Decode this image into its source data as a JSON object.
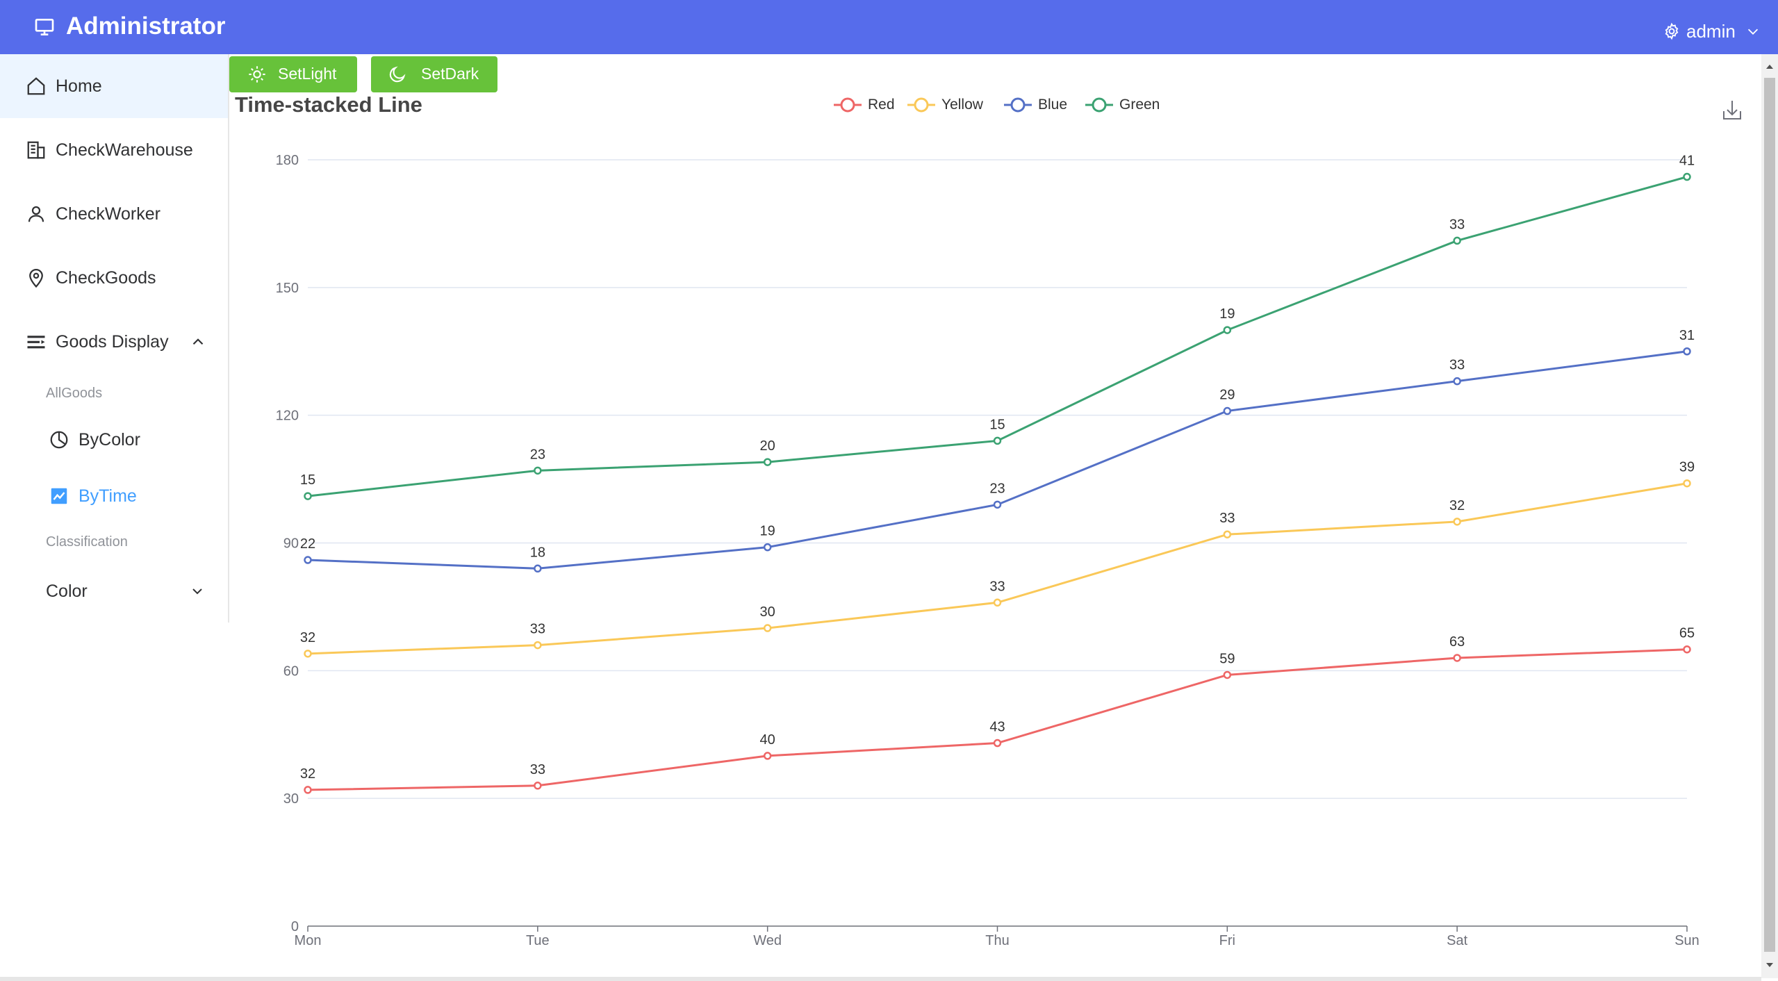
{
  "header": {
    "title": "Administrator",
    "user": "admin",
    "bg_color": "#566ceb"
  },
  "sidebar": {
    "items": [
      {
        "label": "Home",
        "icon": "home-icon"
      },
      {
        "label": "CheckWarehouse",
        "icon": "building-icon"
      },
      {
        "label": "CheckWorker",
        "icon": "user-icon"
      },
      {
        "label": "CheckGoods",
        "icon": "location-pin-icon"
      },
      {
        "label": "Goods Display",
        "icon": "list-icon"
      }
    ],
    "group_allgoods": "AllGoods",
    "sub_items": [
      {
        "label": "ByColor",
        "icon": "pie-chart-icon"
      },
      {
        "label": "ByTime",
        "icon": "line-chart-icon"
      }
    ],
    "group_classification": "Classification",
    "color_menu": "Color",
    "active_color": "#ecf5ff",
    "current_color": "#409eff"
  },
  "buttons": {
    "light": "SetLight",
    "dark": "SetDark",
    "color": "#67c23a"
  },
  "chart_data": {
    "type": "line",
    "title": "Time-stacked Line",
    "stacked": true,
    "categories": [
      "Mon",
      "Tue",
      "Wed",
      "Thu",
      "Fri",
      "Sat",
      "Sun"
    ],
    "series": [
      {
        "name": "Red",
        "color": "#ee6666",
        "values": [
          32,
          33,
          40,
          43,
          59,
          63,
          65
        ]
      },
      {
        "name": "Yellow",
        "color": "#fac858",
        "values": [
          32,
          33,
          30,
          33,
          33,
          32,
          39
        ]
      },
      {
        "name": "Blue",
        "color": "#5470c6",
        "values": [
          22,
          18,
          19,
          23,
          29,
          33,
          31
        ]
      },
      {
        "name": "Green",
        "color": "#3ba272",
        "values": [
          15,
          23,
          20,
          15,
          19,
          33,
          41
        ]
      }
    ],
    "yticks": [
      0,
      30,
      60,
      90,
      120,
      150,
      180
    ],
    "ylim": [
      0,
      180
    ],
    "grid": true,
    "legend_position": "top-center"
  }
}
